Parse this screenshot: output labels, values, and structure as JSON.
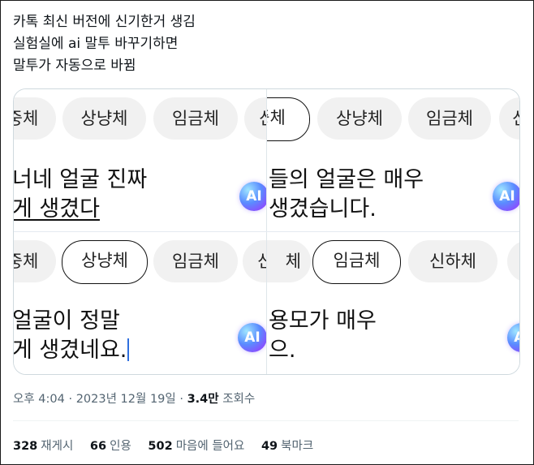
{
  "tweet": {
    "lines": [
      "카톡 최신 버전에 신기한거 생김",
      "실험실에 ai 말투 바꾸기하면",
      "말투가 자동으로 바뀜"
    ]
  },
  "panels": {
    "top_left": {
      "chips": [
        "중체",
        "상냥체",
        "임금체",
        "신"
      ],
      "message_line1": "너네 얼굴 진짜",
      "message_line2": "게 생겼다",
      "badge": "AI"
    },
    "top_right": {
      "chips": [
        "중체",
        "상냥체",
        "임금체",
        "신"
      ],
      "message_line1": "들의 얼굴은 매우",
      "message_line2": " 생겼습니다.",
      "badge": "AI"
    },
    "bottom_left": {
      "chips": [
        "중체",
        "상냥체",
        "임금체",
        "신"
      ],
      "message_line1": "얼굴이 정말",
      "message_line2": "게 생겼네요.",
      "badge": "AI"
    },
    "bottom_right": {
      "chips": [
        "체",
        "임금체",
        "신하체",
        ""
      ],
      "message_line1": "용모가 매우",
      "message_line2": "으.",
      "badge": "AI"
    }
  },
  "meta": {
    "time": "오후 4:04",
    "date": "2023년 12월 19일",
    "views_count": "3.4만",
    "views_label": "조회수"
  },
  "stats": [
    {
      "count": "328",
      "label": "재게시"
    },
    {
      "count": "66",
      "label": "인용"
    },
    {
      "count": "502",
      "label": "마음에 들어요"
    },
    {
      "count": "49",
      "label": "북마크"
    }
  ]
}
